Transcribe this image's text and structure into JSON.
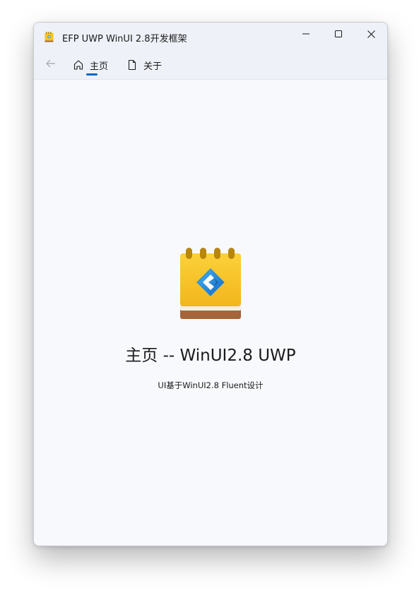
{
  "window": {
    "title": "EFP UWP WinUI 2.8开发框架",
    "app_icon": "notepad-icon",
    "caption_buttons": [
      "minimize",
      "maximize",
      "close"
    ]
  },
  "nav": {
    "back_icon": "back-arrow-icon",
    "items": [
      {
        "label": "主页",
        "icon": "home-icon",
        "selected": true
      },
      {
        "label": "关于",
        "icon": "document-icon",
        "selected": false
      }
    ],
    "settings_icon": "gear-icon",
    "accent": "#0067c0"
  },
  "main": {
    "hero_icon": "notepad-icon",
    "heading": "主页 -- WinUI2.8 UWP",
    "subtitle": "UI基于WinUI2.8 Fluent设计"
  },
  "colors": {
    "titlebar": "#eef1f7",
    "content": "#f8f9fc",
    "notepad_yellow": "#f7c325",
    "notepad_brown": "#a5643a",
    "logo_blue": "#1e88e5"
  }
}
